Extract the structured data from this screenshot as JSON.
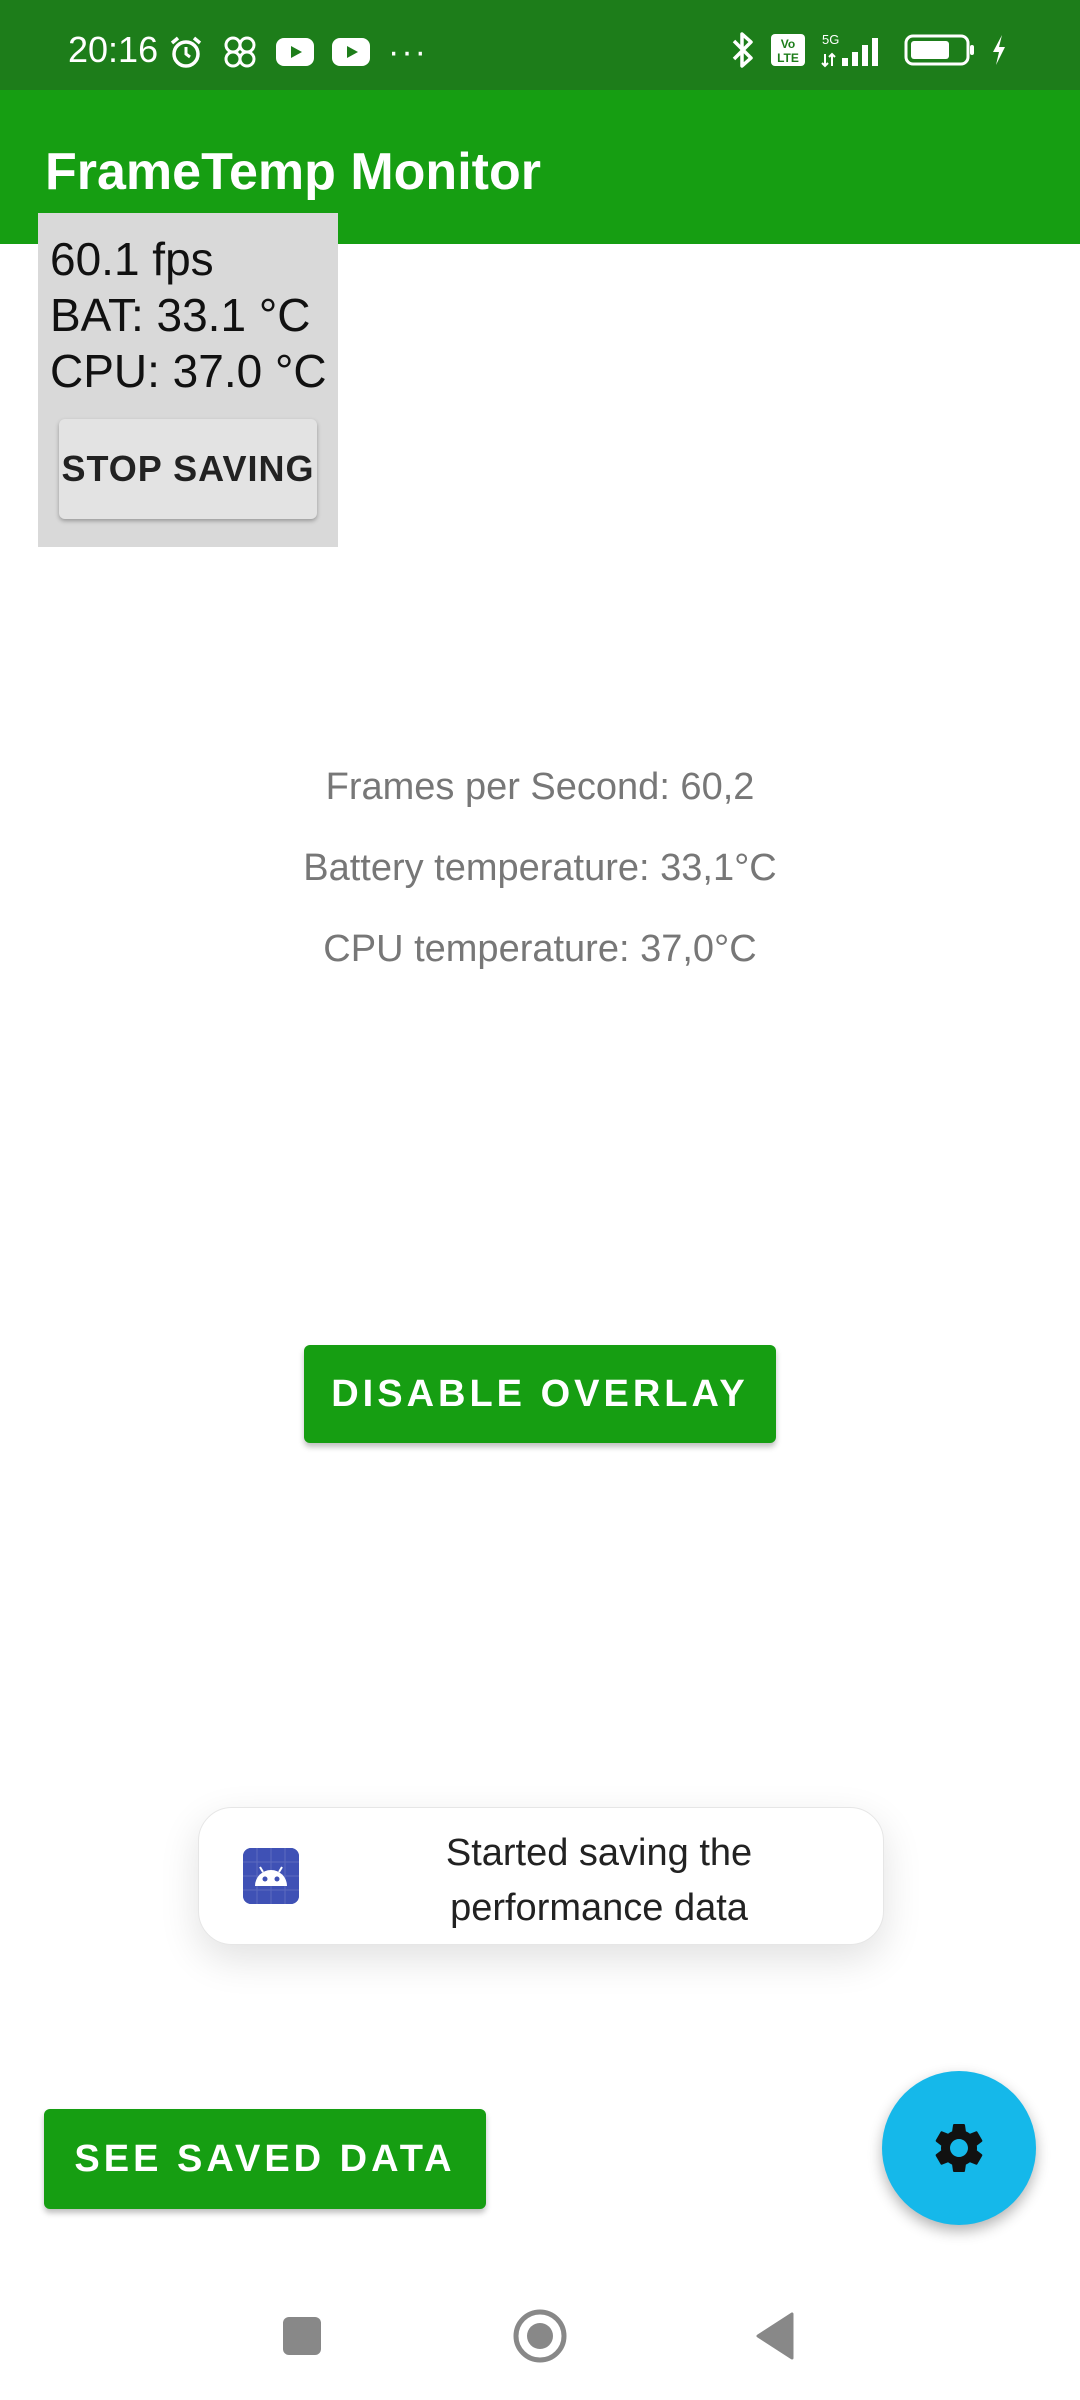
{
  "status_bar": {
    "time": "20:16",
    "dots": "···",
    "network_label": "5G",
    "volte_label": "Vo LTE",
    "bg_color": "#1d7d1a"
  },
  "app_bar": {
    "title": "FrameTemp Monitor",
    "bg_color": "#169e12"
  },
  "overlay": {
    "fps": "60.1 fps",
    "bat": "BAT: 33.1 °C",
    "cpu": "CPU: 37.0 °C",
    "stop_label": "STOP SAVING"
  },
  "stats": {
    "fps": "Frames per Second: 60,2",
    "battery": "Battery temperature: 33,1°C",
    "cpu": "CPU temperature: 37,0°C"
  },
  "buttons": {
    "disable_overlay": "DISABLE OVERLAY",
    "see_saved_data": "SEE SAVED DATA"
  },
  "toast": {
    "line1": "Started saving the",
    "line2": "performance data",
    "icon": "android-icon"
  },
  "fab": {
    "icon": "gear-icon",
    "color": "#15b8ea"
  },
  "nav": {
    "recents_icon": "square-icon",
    "home_icon": "circle-icon",
    "back_icon": "triangle-back-icon"
  }
}
